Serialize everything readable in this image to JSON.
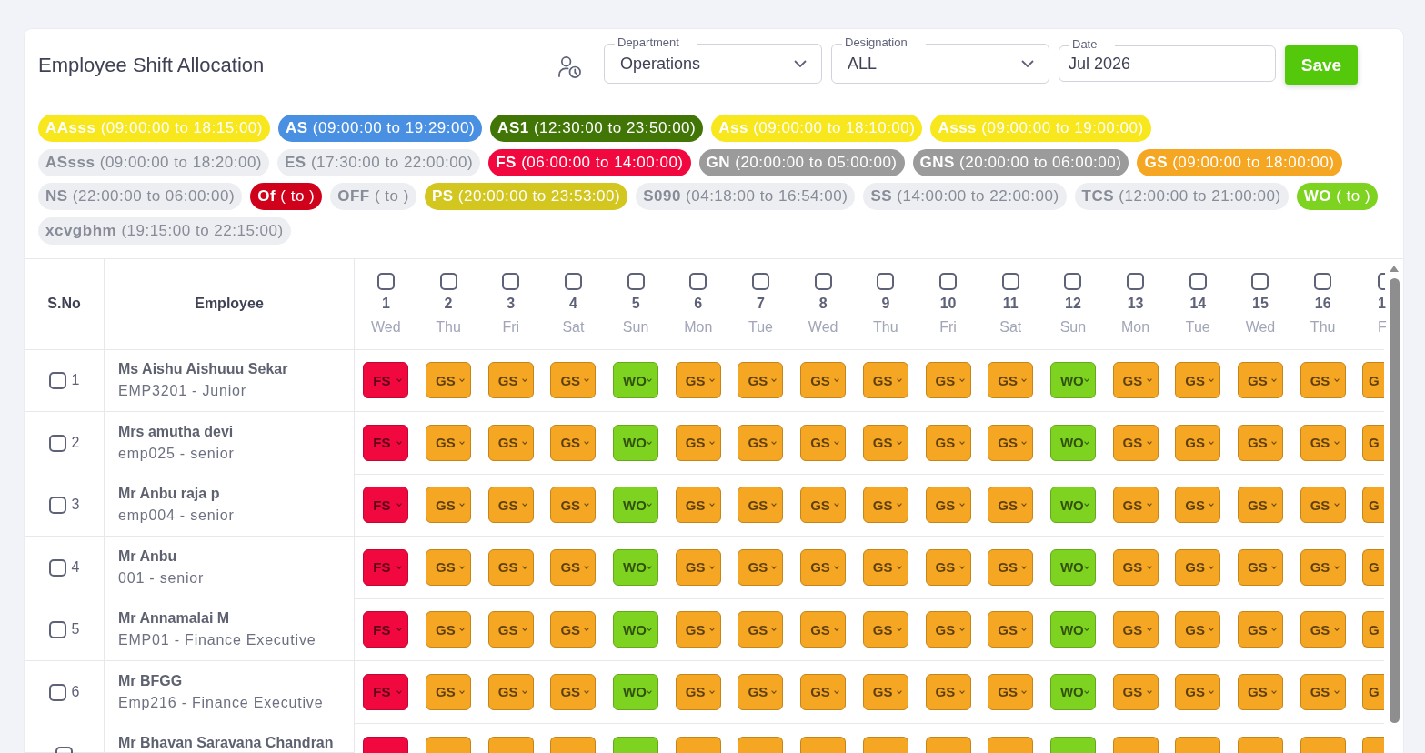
{
  "header": {
    "title": "Employee Shift Allocation",
    "filters": [
      {
        "kind": "select",
        "label": "Department",
        "value": "Operations"
      },
      {
        "kind": "select",
        "label": "Designation",
        "value": "ALL"
      },
      {
        "kind": "date",
        "label": "Date",
        "value": "Jul 2026"
      }
    ],
    "save_button": "Save"
  },
  "legend": [
    {
      "code": "AAsss",
      "time": "(09:00:00 to 18:15:00)",
      "color": "#f8e71c",
      "disabled": false
    },
    {
      "code": "AS",
      "time": "(09:00:00 to 19:29:00)",
      "color": "#4a90e2",
      "disabled": false
    },
    {
      "code": "AS1",
      "time": "(12:30:00 to 23:50:00)",
      "color": "#417505",
      "disabled": false
    },
    {
      "code": "Ass",
      "time": "(09:00:00 to 18:10:00)",
      "color": "#f8e71c",
      "disabled": false
    },
    {
      "code": "Asss",
      "time": "(09:00:00 to 19:00:00)",
      "color": "#f8e71c",
      "disabled": false
    },
    {
      "code": "ASsss",
      "time": "(09:00:00 to 18:20:00)",
      "disabled": true
    },
    {
      "code": "ES",
      "time": "(17:30:00 to 22:00:00)",
      "disabled": true
    },
    {
      "code": "FS",
      "time": "(06:00:00 to 14:00:00)",
      "color": "#f0083e",
      "disabled": false
    },
    {
      "code": "GN",
      "time": "(20:00:00 to 05:00:00)",
      "color": "#9b9b9b",
      "disabled": false
    },
    {
      "code": "GNS",
      "time": "(20:00:00 to 06:00:00)",
      "color": "#9b9b9b",
      "disabled": false
    },
    {
      "code": "GS",
      "time": "(09:00:00 to 18:00:00)",
      "color": "#f5a623",
      "disabled": false
    },
    {
      "code": "NS",
      "time": "(22:00:00 to 06:00:00)",
      "disabled": true
    },
    {
      "code": "Of",
      "time": "( to )",
      "color": "#d0021b",
      "disabled": false
    },
    {
      "code": "OFF",
      "time": "( to )",
      "disabled": true
    },
    {
      "code": "PS",
      "time": "(20:00:00 to 23:53:00)",
      "color": "#d2c61f",
      "disabled": false
    },
    {
      "code": "S090",
      "time": "(04:18:00 to 16:54:00)",
      "disabled": true
    },
    {
      "code": "SS",
      "time": "(14:00:00 to 22:00:00)",
      "disabled": true
    },
    {
      "code": "TCS",
      "time": "(12:00:00 to 21:00:00)",
      "disabled": true
    },
    {
      "code": "WO",
      "time": "( to )",
      "color": "#7ed321",
      "disabled": false
    },
    {
      "code": "xcvgbhm",
      "time": "(19:15:00 to 22:15:00)",
      "disabled": true
    }
  ],
  "table": {
    "columns": [
      "S.No",
      "Employee"
    ],
    "days": [
      {
        "day": "1",
        "weekday": "Wed",
        "checked": false
      },
      {
        "day": "2",
        "weekday": "Thu",
        "checked": false
      },
      {
        "day": "3",
        "weekday": "Fri",
        "checked": false
      },
      {
        "day": "4",
        "weekday": "Sat",
        "checked": false
      },
      {
        "day": "5",
        "weekday": "Sun",
        "checked": false
      },
      {
        "day": "6",
        "weekday": "Mon",
        "checked": false
      },
      {
        "day": "7",
        "weekday": "Tue",
        "checked": false
      },
      {
        "day": "8",
        "weekday": "Wed",
        "checked": false
      },
      {
        "day": "9",
        "weekday": "Thu",
        "checked": false
      },
      {
        "day": "10",
        "weekday": "Fri",
        "checked": false
      },
      {
        "day": "11",
        "weekday": "Sat",
        "checked": false
      },
      {
        "day": "12",
        "weekday": "Sun",
        "checked": false
      },
      {
        "day": "13",
        "weekday": "Mon",
        "checked": false
      },
      {
        "day": "14",
        "weekday": "Tue",
        "checked": false
      },
      {
        "day": "15",
        "weekday": "Wed",
        "checked": false
      },
      {
        "day": "16",
        "weekday": "Thu",
        "checked": false
      },
      {
        "day": "1",
        "weekday": "F",
        "checked": false
      }
    ],
    "rows": [
      {
        "serial": "1",
        "checked": false,
        "name": "Ms Aishu Aishuuu Sekar",
        "detail": "EMP3201 - Junior",
        "cells": [
          {
            "code": "FS",
            "color": "#f0083e"
          },
          {
            "code": "GS",
            "color": "#f5a623"
          },
          {
            "code": "GS",
            "color": "#f5a623"
          },
          {
            "code": "GS",
            "color": "#f5a623"
          },
          {
            "code": "WO",
            "color": "#7ed321"
          },
          {
            "code": "GS",
            "color": "#f5a623"
          },
          {
            "code": "GS",
            "color": "#f5a623"
          },
          {
            "code": "GS",
            "color": "#f5a623"
          },
          {
            "code": "GS",
            "color": "#f5a623"
          },
          {
            "code": "GS",
            "color": "#f5a623"
          },
          {
            "code": "GS",
            "color": "#f5a623"
          },
          {
            "code": "WO",
            "color": "#7ed321"
          },
          {
            "code": "GS",
            "color": "#f5a623"
          },
          {
            "code": "GS",
            "color": "#f5a623"
          },
          {
            "code": "GS",
            "color": "#f5a623"
          },
          {
            "code": "GS",
            "color": "#f5a623"
          },
          {
            "code": "G",
            "color": "#f5a623"
          }
        ]
      },
      {
        "serial": "2",
        "checked": false,
        "name": "Mrs amutha devi",
        "detail": "emp025 - senior",
        "cells": [
          {
            "code": "FS",
            "color": "#f0083e"
          },
          {
            "code": "GS",
            "color": "#f5a623"
          },
          {
            "code": "GS",
            "color": "#f5a623"
          },
          {
            "code": "GS",
            "color": "#f5a623"
          },
          {
            "code": "WO",
            "color": "#7ed321"
          },
          {
            "code": "GS",
            "color": "#f5a623"
          },
          {
            "code": "GS",
            "color": "#f5a623"
          },
          {
            "code": "GS",
            "color": "#f5a623"
          },
          {
            "code": "GS",
            "color": "#f5a623"
          },
          {
            "code": "GS",
            "color": "#f5a623"
          },
          {
            "code": "GS",
            "color": "#f5a623"
          },
          {
            "code": "WO",
            "color": "#7ed321"
          },
          {
            "code": "GS",
            "color": "#f5a623"
          },
          {
            "code": "GS",
            "color": "#f5a623"
          },
          {
            "code": "GS",
            "color": "#f5a623"
          },
          {
            "code": "GS",
            "color": "#f5a623"
          },
          {
            "code": "G",
            "color": "#f5a623"
          }
        ]
      },
      {
        "serial": "3",
        "checked": false,
        "name": "Mr Anbu raja p",
        "detail": "emp004 - senior",
        "cells": [
          {
            "code": "FS",
            "color": "#f0083e"
          },
          {
            "code": "GS",
            "color": "#f5a623"
          },
          {
            "code": "GS",
            "color": "#f5a623"
          },
          {
            "code": "GS",
            "color": "#f5a623"
          },
          {
            "code": "WO",
            "color": "#7ed321"
          },
          {
            "code": "GS",
            "color": "#f5a623"
          },
          {
            "code": "GS",
            "color": "#f5a623"
          },
          {
            "code": "GS",
            "color": "#f5a623"
          },
          {
            "code": "GS",
            "color": "#f5a623"
          },
          {
            "code": "GS",
            "color": "#f5a623"
          },
          {
            "code": "GS",
            "color": "#f5a623"
          },
          {
            "code": "WO",
            "color": "#7ed321"
          },
          {
            "code": "GS",
            "color": "#f5a623"
          },
          {
            "code": "GS",
            "color": "#f5a623"
          },
          {
            "code": "GS",
            "color": "#f5a623"
          },
          {
            "code": "GS",
            "color": "#f5a623"
          },
          {
            "code": "G",
            "color": "#f5a623"
          }
        ]
      },
      {
        "serial": "4",
        "checked": false,
        "name": "Mr Anbu",
        "detail": "001 - senior",
        "cells": [
          {
            "code": "FS",
            "color": "#f0083e"
          },
          {
            "code": "GS",
            "color": "#f5a623"
          },
          {
            "code": "GS",
            "color": "#f5a623"
          },
          {
            "code": "GS",
            "color": "#f5a623"
          },
          {
            "code": "WO",
            "color": "#7ed321"
          },
          {
            "code": "GS",
            "color": "#f5a623"
          },
          {
            "code": "GS",
            "color": "#f5a623"
          },
          {
            "code": "GS",
            "color": "#f5a623"
          },
          {
            "code": "GS",
            "color": "#f5a623"
          },
          {
            "code": "GS",
            "color": "#f5a623"
          },
          {
            "code": "GS",
            "color": "#f5a623"
          },
          {
            "code": "WO",
            "color": "#7ed321"
          },
          {
            "code": "GS",
            "color": "#f5a623"
          },
          {
            "code": "GS",
            "color": "#f5a623"
          },
          {
            "code": "GS",
            "color": "#f5a623"
          },
          {
            "code": "GS",
            "color": "#f5a623"
          },
          {
            "code": "G",
            "color": "#f5a623"
          }
        ]
      },
      {
        "serial": "5",
        "checked": false,
        "name": "Mr Annamalai M",
        "detail": "EMP01 - Finance Executive",
        "cells": [
          {
            "code": "FS",
            "color": "#f0083e"
          },
          {
            "code": "GS",
            "color": "#f5a623"
          },
          {
            "code": "GS",
            "color": "#f5a623"
          },
          {
            "code": "GS",
            "color": "#f5a623"
          },
          {
            "code": "WO",
            "color": "#7ed321"
          },
          {
            "code": "GS",
            "color": "#f5a623"
          },
          {
            "code": "GS",
            "color": "#f5a623"
          },
          {
            "code": "GS",
            "color": "#f5a623"
          },
          {
            "code": "GS",
            "color": "#f5a623"
          },
          {
            "code": "GS",
            "color": "#f5a623"
          },
          {
            "code": "GS",
            "color": "#f5a623"
          },
          {
            "code": "WO",
            "color": "#7ed321"
          },
          {
            "code": "GS",
            "color": "#f5a623"
          },
          {
            "code": "GS",
            "color": "#f5a623"
          },
          {
            "code": "GS",
            "color": "#f5a623"
          },
          {
            "code": "GS",
            "color": "#f5a623"
          },
          {
            "code": "G",
            "color": "#f5a623"
          }
        ]
      },
      {
        "serial": "6",
        "checked": false,
        "name": "Mr BFGG",
        "detail": "Emp216 - Finance Executive",
        "cells": [
          {
            "code": "FS",
            "color": "#f0083e"
          },
          {
            "code": "GS",
            "color": "#f5a623"
          },
          {
            "code": "GS",
            "color": "#f5a623"
          },
          {
            "code": "GS",
            "color": "#f5a623"
          },
          {
            "code": "WO",
            "color": "#7ed321"
          },
          {
            "code": "GS",
            "color": "#f5a623"
          },
          {
            "code": "GS",
            "color": "#f5a623"
          },
          {
            "code": "GS",
            "color": "#f5a623"
          },
          {
            "code": "GS",
            "color": "#f5a623"
          },
          {
            "code": "GS",
            "color": "#f5a623"
          },
          {
            "code": "GS",
            "color": "#f5a623"
          },
          {
            "code": "WO",
            "color": "#7ed321"
          },
          {
            "code": "GS",
            "color": "#f5a623"
          },
          {
            "code": "GS",
            "color": "#f5a623"
          },
          {
            "code": "GS",
            "color": "#f5a623"
          },
          {
            "code": "GS",
            "color": "#f5a623"
          },
          {
            "code": "G",
            "color": "#f5a623"
          }
        ]
      },
      {
        "checked": false,
        "name": "Mr Bhavan Saravana Chandran",
        "cells": [
          {
            "color": "#f0083e"
          },
          {
            "color": "#f5a623"
          },
          {
            "color": "#f5a623"
          },
          {
            "color": "#f5a623"
          },
          {
            "color": "#7ed321"
          },
          {
            "color": "#f5a623"
          },
          {
            "color": "#f5a623"
          },
          {
            "color": "#f5a623"
          },
          {
            "color": "#f5a623"
          },
          {
            "color": "#f5a623"
          },
          {
            "color": "#f5a623"
          },
          {
            "color": "#7ed321"
          },
          {
            "color": "#f5a623"
          },
          {
            "color": "#f5a623"
          },
          {
            "color": "#f5a623"
          },
          {
            "color": "#f5a623"
          },
          {
            "color": "#f5a623"
          }
        ]
      }
    ]
  }
}
